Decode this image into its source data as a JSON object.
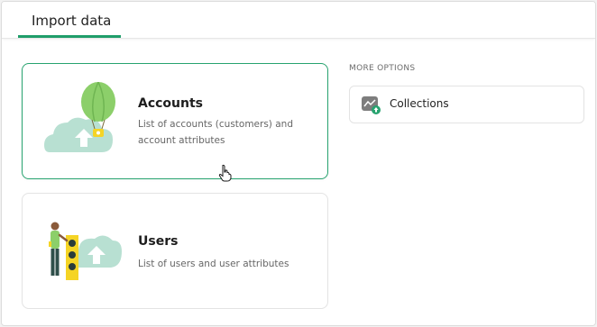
{
  "tabs": [
    {
      "label": "Import data",
      "active": true
    }
  ],
  "cards": {
    "accounts": {
      "title": "Accounts",
      "description": "List of accounts (customers) and account attributes",
      "icon": "balloon-cloud-upload-illustration"
    },
    "users": {
      "title": "Users",
      "description": "List of users and user attributes",
      "icon": "person-users-cloud-illustration"
    }
  },
  "more_options": {
    "heading": "MORE OPTIONS",
    "items": [
      {
        "label": "Collections",
        "icon": "collections-chart-upload-icon"
      }
    ]
  },
  "colors": {
    "accent": "#1f9d6a",
    "cloud": "#b8e0d2",
    "balloon": "#8ccf6a",
    "highlight": "#f5d425"
  }
}
